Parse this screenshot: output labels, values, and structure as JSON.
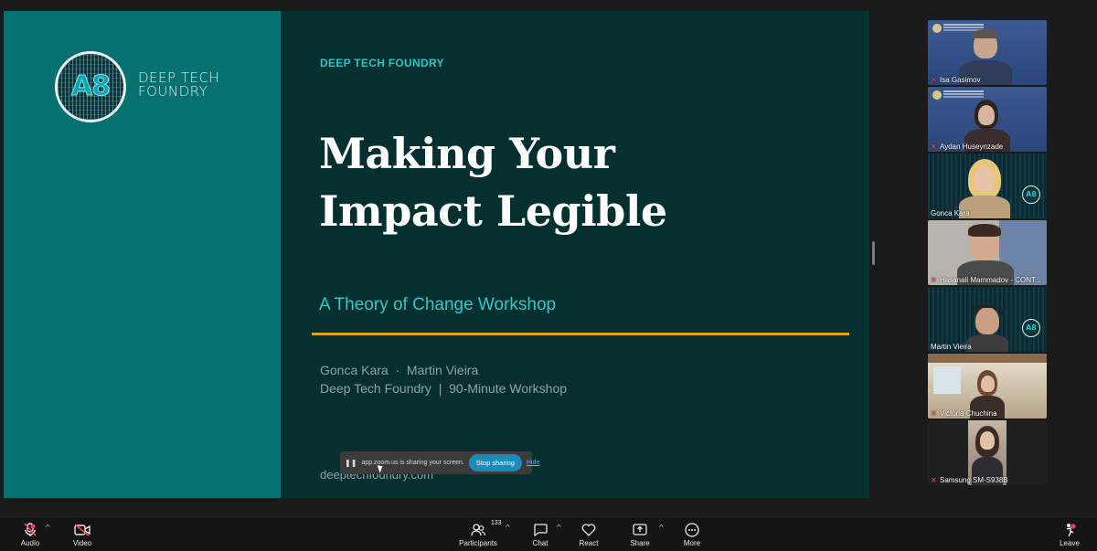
{
  "slide": {
    "brand_line1": "DEEP TECH",
    "brand_line2": "FOUNDRY",
    "logo_text": "A8",
    "eyebrow": "DEEP TECH FOUNDRY",
    "title_line1": "Making Your",
    "title_line2": "Impact Legible",
    "subtitle": "A Theory of Change Workshop",
    "authors": "Gonca Kara  ·  Martin Vieira",
    "org_line": "Deep Tech Foundry  |  90-Minute Workshop",
    "url": "deeptechfoundry.com"
  },
  "share_bar": {
    "pause_icon": "pause-icon",
    "message": "app.zoom.us is sharing your screen.",
    "stop_label": "Stop sharing",
    "hide_label": "Hide"
  },
  "participants": [
    {
      "name": "Isa Gasimov",
      "muted": true
    },
    {
      "name": "Aydan Huseynzade",
      "muted": true
    },
    {
      "name": "Gonca Kara",
      "muted": false,
      "active": true
    },
    {
      "name": "Hasanali Mammadov - CONT...",
      "muted": true
    },
    {
      "name": "Martin Vieira",
      "muted": false
    },
    {
      "name": "Victoria Chuchina",
      "muted": true
    },
    {
      "name": "Samsung SM-S938B",
      "muted": true
    }
  ],
  "toolbar": {
    "audio": "Audio",
    "video": "Video",
    "participants": "Participants",
    "participants_count": "133",
    "chat": "Chat",
    "react": "React",
    "share": "Share",
    "more": "More",
    "leave": "Leave"
  },
  "colors": {
    "slide_bg": "#06302f",
    "slide_left": "#077070",
    "accent_teal": "#2dc4c4",
    "rule_gold": "#e0a414",
    "active_speaker": "#2fc58a"
  }
}
